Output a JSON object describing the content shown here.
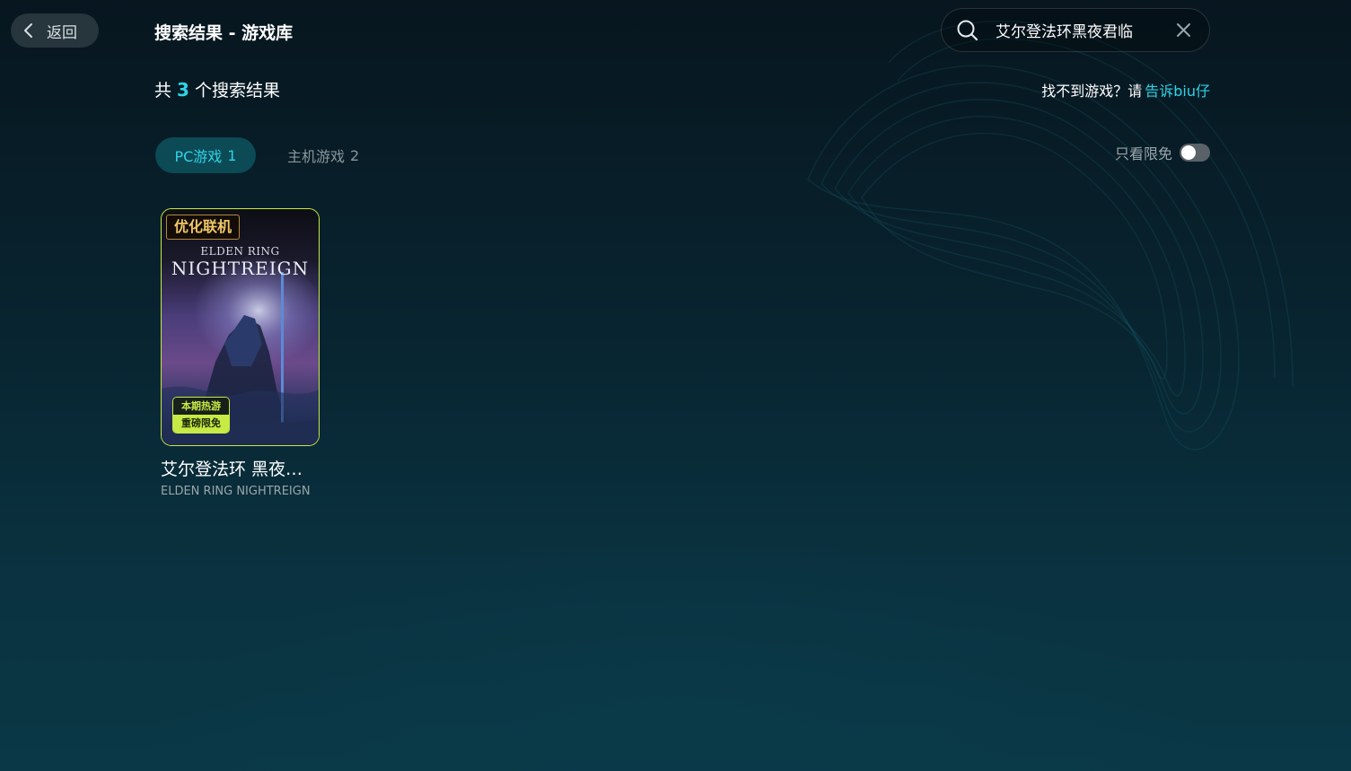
{
  "header": {
    "back_label": "返回",
    "title": "搜索结果 - 游戏库"
  },
  "search": {
    "value": "艾尔登法环黑夜君临",
    "icon": "search-icon",
    "clear_icon": "close-icon"
  },
  "results": {
    "prefix": "共",
    "count": "3",
    "suffix": "个搜索结果"
  },
  "help": {
    "text": "找不到游戏？请",
    "link": "告诉biu仔"
  },
  "tabs": [
    {
      "label": "PC游戏",
      "count": "1",
      "active": true
    },
    {
      "label": "主机游戏",
      "count": "2",
      "active": false
    }
  ],
  "filter": {
    "label": "只看限免",
    "on": false
  },
  "games": [
    {
      "tag": "优化联机",
      "cover_title_small": "ELDEN RING",
      "cover_title_large": "NIGHTREIGN",
      "badge_line1": "本期热游",
      "badge_line2": "重磅限免",
      "name": "艾尔登法环 黑夜君临",
      "subtitle": "ELDEN RING NIGHTREIGN"
    }
  ],
  "colors": {
    "accent": "#2fd3e6",
    "card_border": "#c7ea45",
    "tab_active_bg": "#0c4a55"
  }
}
